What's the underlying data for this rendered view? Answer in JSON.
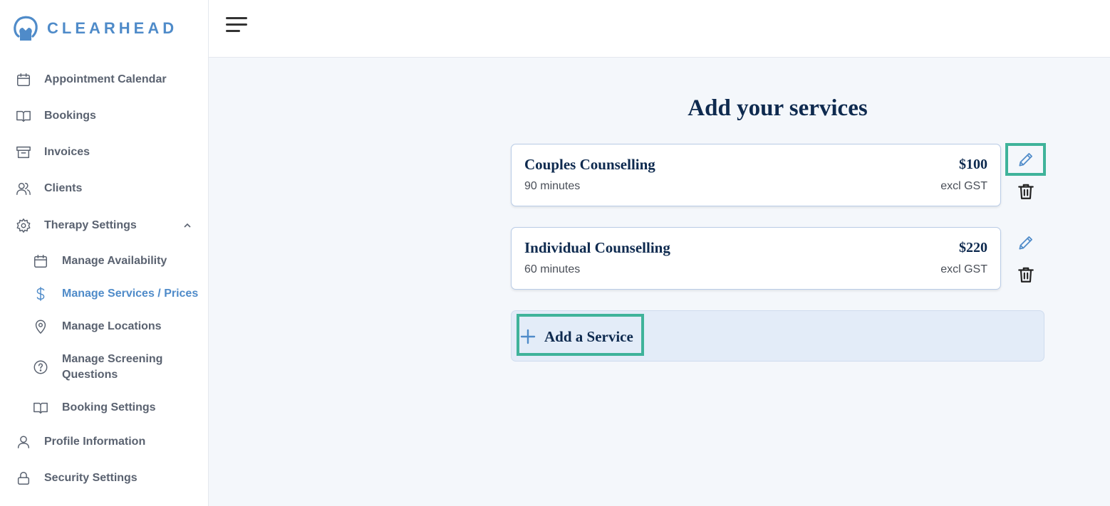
{
  "brand": {
    "name": "CLEARHEAD",
    "accent": "#4f8bc9",
    "highlight": "#3fb39a"
  },
  "sidebar": {
    "items": [
      {
        "label": "Appointment Calendar",
        "icon": "calendar-icon"
      },
      {
        "label": "Bookings",
        "icon": "book-icon"
      },
      {
        "label": "Invoices",
        "icon": "archive-icon"
      },
      {
        "label": "Clients",
        "icon": "users-icon"
      },
      {
        "label": "Therapy Settings",
        "icon": "gear-icon",
        "expanded": true
      }
    ],
    "subitems": [
      {
        "label": "Manage Availability",
        "icon": "calendar-icon"
      },
      {
        "label": "Manage Services / Prices",
        "icon": "dollar-icon",
        "active": true
      },
      {
        "label": "Manage Locations",
        "icon": "map-pin-icon"
      },
      {
        "label": "Manage Screening Questions",
        "icon": "help-circle-icon"
      },
      {
        "label": "Booking Settings",
        "icon": "book-icon"
      }
    ],
    "bottom_items": [
      {
        "label": "Profile Information",
        "icon": "user-icon"
      },
      {
        "label": "Security Settings",
        "icon": "lock-icon"
      }
    ]
  },
  "main": {
    "title": "Add your services",
    "services": [
      {
        "name": "Couples Counselling",
        "duration": "90 minutes",
        "price": "$100",
        "tax": "excl GST"
      },
      {
        "name": "Individual Counselling",
        "duration": "60 minutes",
        "price": "$220",
        "tax": "excl GST"
      }
    ],
    "add_label": "Add a Service"
  }
}
